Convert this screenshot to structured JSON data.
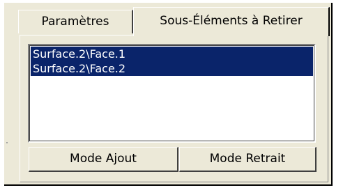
{
  "tabs": {
    "parametres": "Paramètres",
    "sous_elements": "Sous-Éléments à Retirer"
  },
  "list": {
    "items": [
      "Surface.2\\Face.1",
      "Surface.2\\Face.2"
    ]
  },
  "buttons": {
    "mode_ajout": "Mode Ajout",
    "mode_retrait": "Mode Retrait"
  },
  "colors": {
    "selection": "#0a246a",
    "dialog_bg": "#ece9d8"
  }
}
